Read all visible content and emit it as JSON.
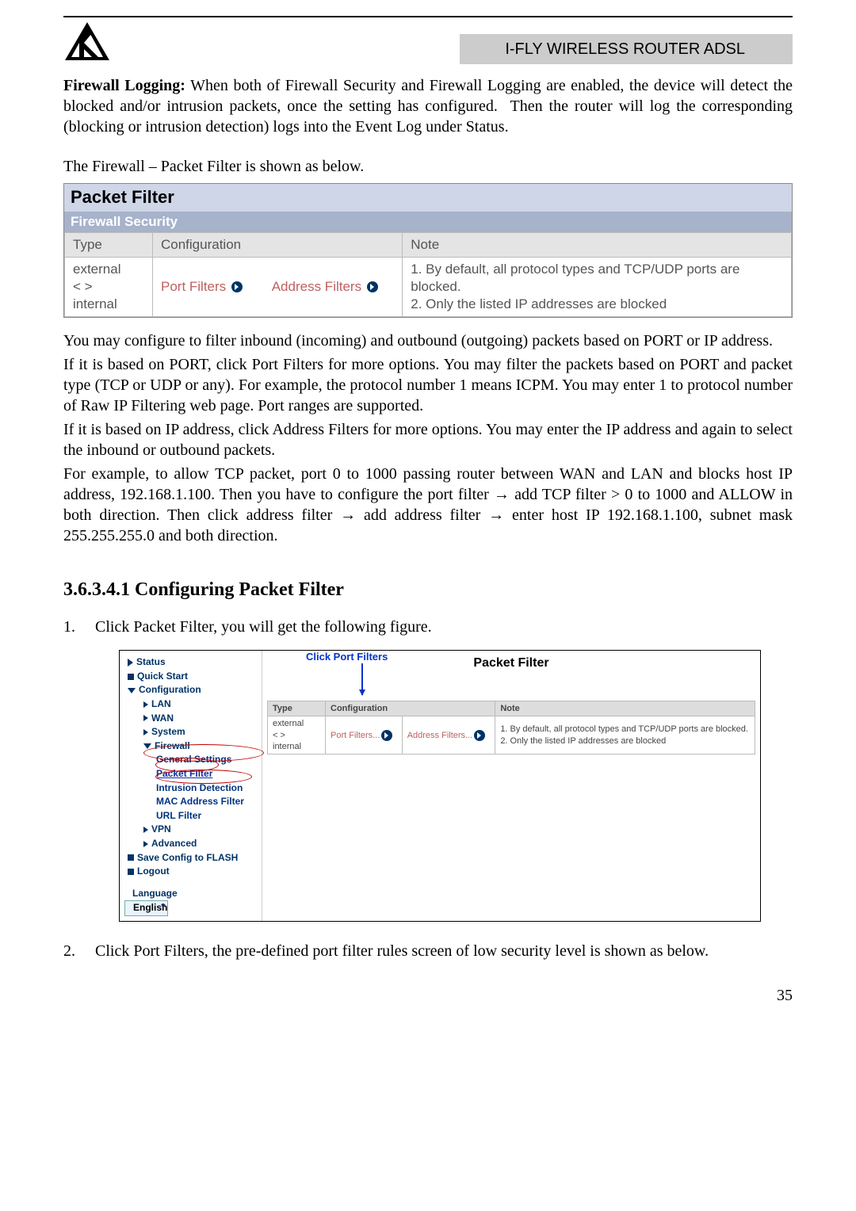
{
  "header": {
    "doc_title": "I-FLY WIRELESS ROUTER ADSL"
  },
  "para1": "Firewall Logging: When both of Firewall Security and Firewall Logging are enabled, the device will detect the blocked and/or intrusion packets, once the setting has configured.  Then the router will log the corresponding (blocking or intrusion detection) logs into the Event Log under Status.",
  "para2": "The Firewall – Packet Filter is shown as below.",
  "packet_filter": {
    "title": "Packet Filter",
    "subtitle": "Firewall Security",
    "col_type": "Type",
    "col_config": "Configuration",
    "col_note": "Note",
    "row": {
      "type": "external\n< >\ninternal",
      "port_filters": "Port Filters",
      "address_filters": "Address Filters",
      "note": "1. By default, all protocol types and TCP/UDP ports are blocked.\n2. Only the listed IP addresses are blocked"
    }
  },
  "para3": "You may configure to filter inbound (incoming) and outbound (outgoing) packets based on PORT or IP address.",
  "para4": "If it is based on PORT, click Port Filters for more options. You may filter the packets based on PORT and packet type (TCP or UDP or any). For example, the protocol number 1 means ICPM. You may enter 1 to protocol number of Raw IP Filtering web page. Port ranges are supported.",
  "para5": "If it is based on IP address, click Address Filters for more options. You may enter the IP address and again to select the inbound or outbound packets.",
  "para6": "For example, to allow TCP packet, port 0 to 1000 passing router between WAN and LAN and blocks host IP address, 192.168.1.100. Then you have to configure the port filter → add TCP filter > 0 to 1000 and ALLOW in both direction. Then click address filter → add address filter → enter host IP 192.168.1.100, subnet mask 255.255.255.0 and both direction.",
  "section_title": "3.6.3.4.1 Configuring Packet Filter",
  "step1_num": "1.",
  "step1_text": "Click Packet Filter, you will get the following figure.",
  "embed": {
    "callout": "Click Port Filters",
    "sidebar": {
      "status": "Status",
      "quick": "Quick Start",
      "config": "Configuration",
      "lan": "LAN",
      "wan": "WAN",
      "system": "System",
      "firewall": "Firewall",
      "general": "General Settings",
      "packet": "Packet Filter",
      "intrusion": "Intrusion Detection",
      "mac": "MAC Address Filter",
      "url": "URL Filter",
      "vpn": "VPN",
      "advanced": "Advanced",
      "save": "Save Config to FLASH",
      "logout": "Logout",
      "language_label": "Language",
      "language_value": "English"
    },
    "table": {
      "title": "Packet Filter",
      "col_type": "Type",
      "col_config": "Configuration",
      "col_note": "Note",
      "row_type": "external\n< >\ninternal",
      "row_pf": "Port Filters...",
      "row_af": "Address Filters...",
      "row_note": "1. By default, all protocol types and TCP/UDP ports are blocked.\n2. Only the listed IP addresses are blocked"
    }
  },
  "step2_num": "2.",
  "step2_text": "Click Port Filters, the pre-defined port filter rules screen of low security level is shown as below.",
  "page_number": "35"
}
